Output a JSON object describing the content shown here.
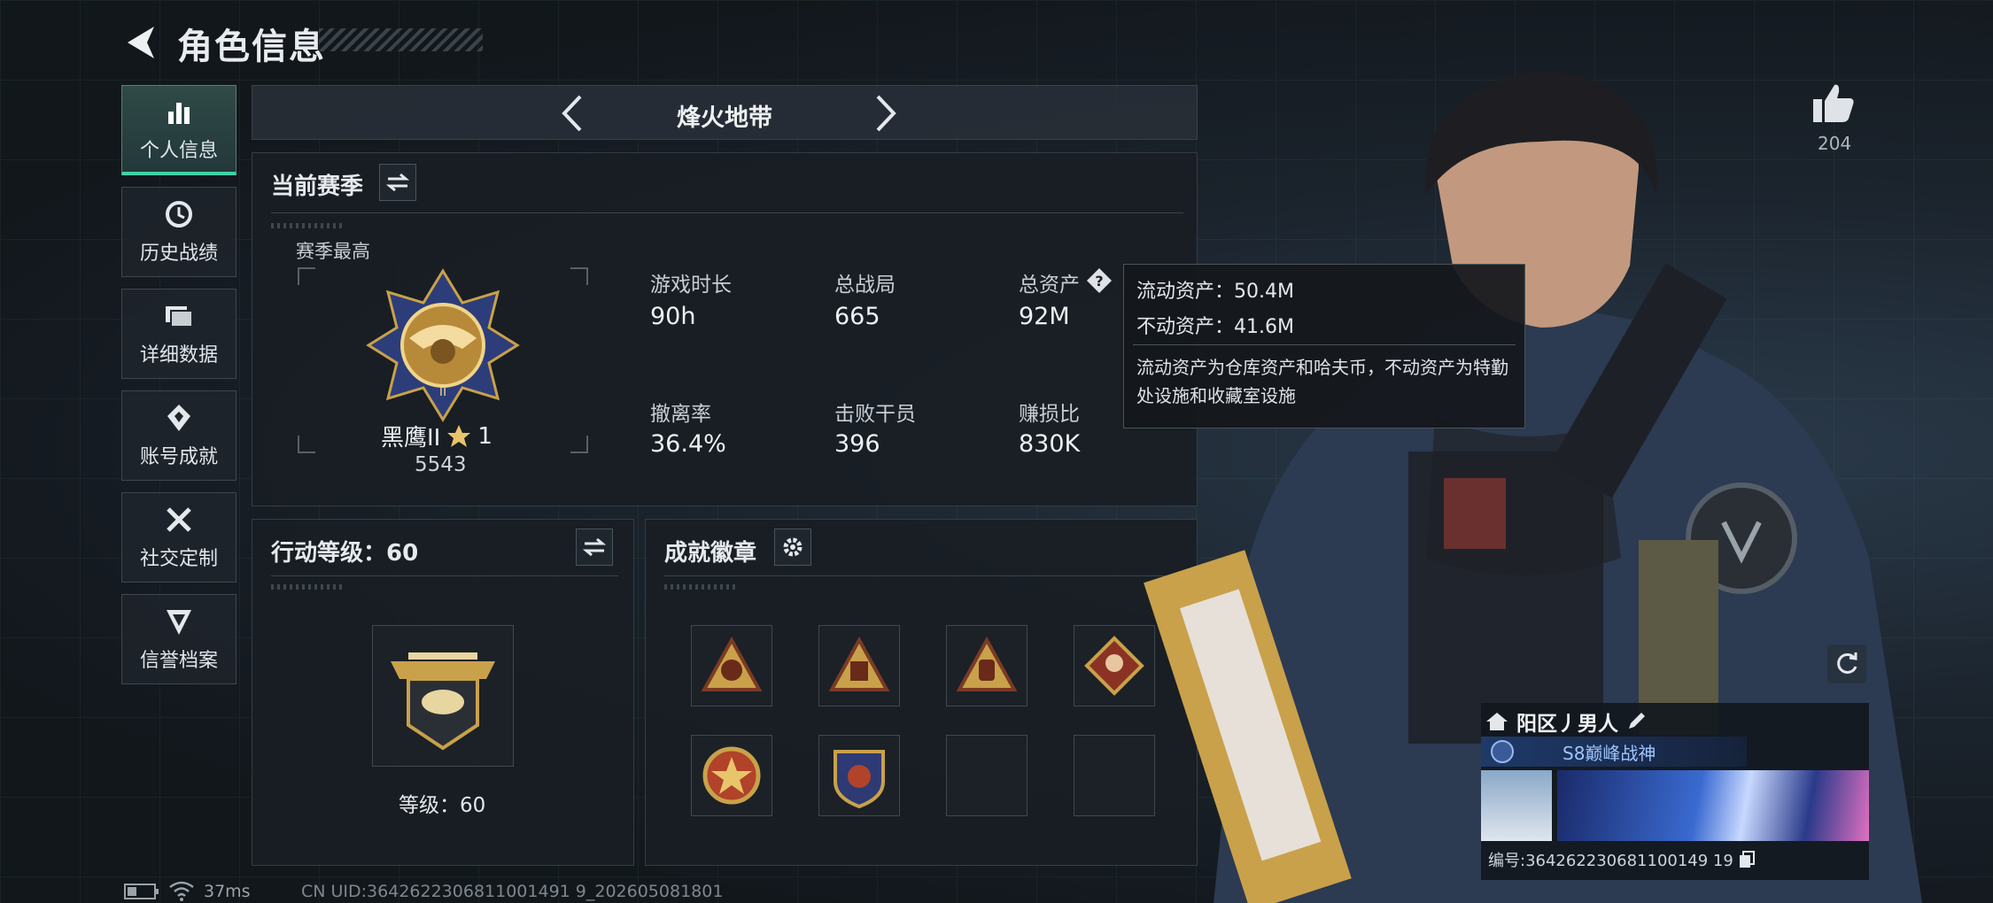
{
  "header": {
    "title": "角色信息"
  },
  "sidebar": {
    "items": [
      {
        "label": "个人信息",
        "icon": "bar-chart-icon",
        "active": true
      },
      {
        "label": "历史战绩",
        "icon": "history-icon"
      },
      {
        "label": "详细数据",
        "icon": "folder-icon"
      },
      {
        "label": "账号成就",
        "icon": "achievement-icon"
      },
      {
        "label": "社交定制",
        "icon": "tools-icon"
      },
      {
        "label": "信誉档案",
        "icon": "reputation-icon"
      }
    ]
  },
  "mode": {
    "name": "烽火地带"
  },
  "season": {
    "title": "当前赛季",
    "best_label": "赛季最高",
    "rank_name": "黑鹰II",
    "rank_stars": "1",
    "rank_points": "5543",
    "stats": [
      {
        "label": "游戏时长",
        "value": "90h"
      },
      {
        "label": "总战局",
        "value": "665"
      },
      {
        "label": "总资产",
        "value": "92M"
      },
      {
        "label": "撤离率",
        "value": "36.4%"
      },
      {
        "label": "击败干员",
        "value": "396"
      },
      {
        "label": "赚损比",
        "value": "830K"
      }
    ]
  },
  "tooltip": {
    "liquid": "流动资产：50.4M",
    "fixed": "不动资产：41.6M",
    "note": "流动资产为仓库资产和哈夫币，不动资产为特勤处设施和收藏室设施"
  },
  "level": {
    "title": "行动等级：60",
    "level_text": "等级：60"
  },
  "badges": {
    "title": "成就徽章",
    "count_filled": 6,
    "count_slots": 8
  },
  "profile": {
    "likes": "204",
    "player_name": "阳区丿男人",
    "title_tag": "S8巅峰战神",
    "id_text": "编号:364262230681100149 19"
  },
  "status_bar": {
    "ping": "37ms",
    "uid": "CN UID:3642622306811001491 9_202605081801"
  },
  "colors": {
    "accent": "#3fd3a8",
    "panel": "#181e24",
    "gold": "#c9a14a"
  }
}
